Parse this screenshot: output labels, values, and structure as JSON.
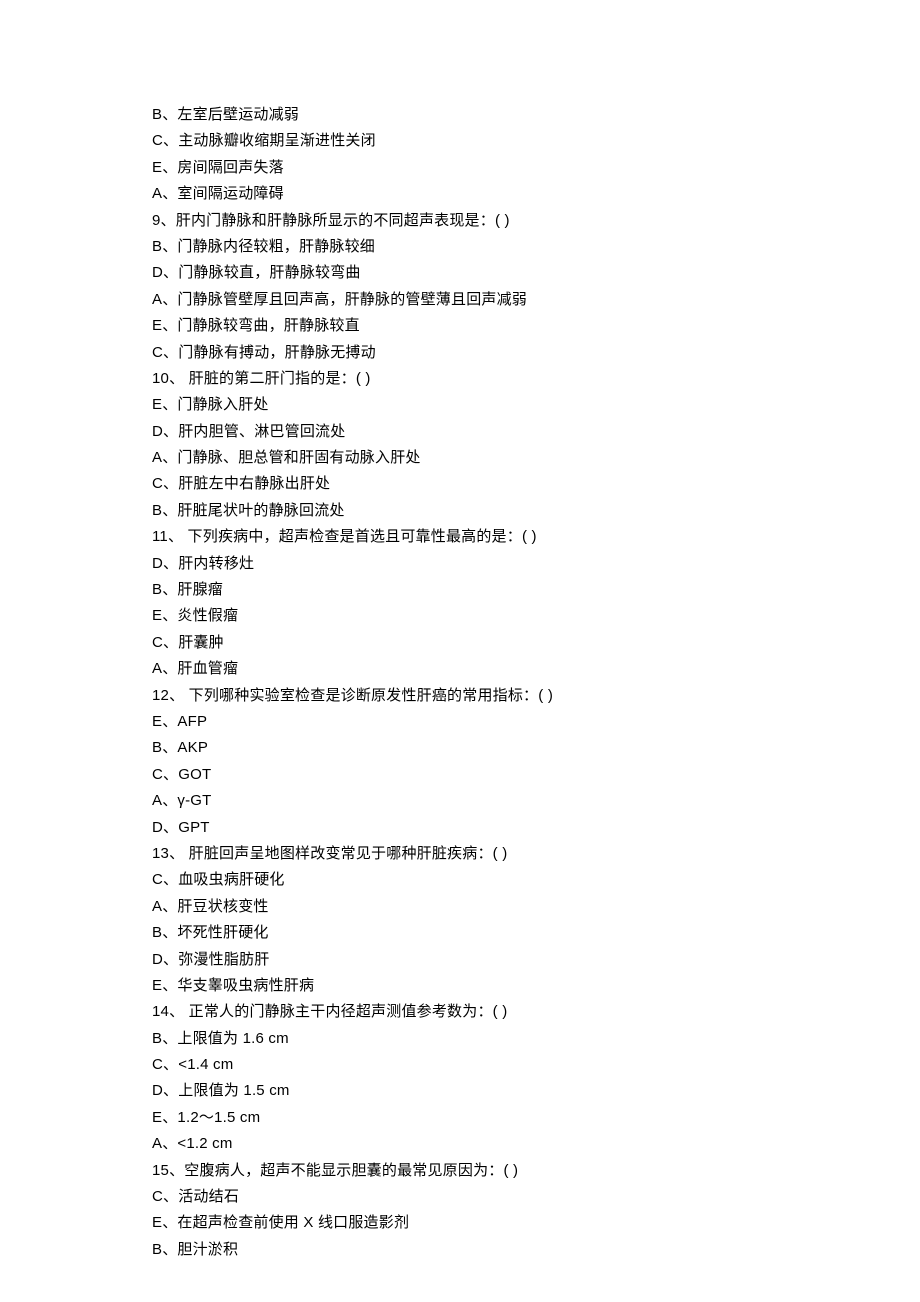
{
  "lines": [
    "B、左室后壁运动减弱",
    "C、主动脉瓣收缩期呈渐进性关闭",
    "E、房间隔回声失落",
    "A、室间隔运动障碍",
    "9、肝内门静脉和肝静脉所显示的不同超声表现是：(  )",
    "B、门静脉内径较粗，肝静脉较细",
    "D、门静脉较直，肝静脉较弯曲",
    "A、门静脉管壁厚且回声高，肝静脉的管壁薄且回声减弱",
    "E、门静脉较弯曲，肝静脉较直",
    "C、门静脉有搏动，肝静脉无搏动",
    "10、  肝脏的第二肝门指的是：(  )",
    "E、门静脉入肝处",
    "D、肝内胆管、淋巴管回流处",
    "A、门静脉、胆总管和肝固有动脉入肝处",
    "C、肝脏左中右静脉出肝处",
    "B、肝脏尾状叶的静脉回流处",
    "11、  下列疾病中，超声检查是首选且可靠性最高的是：(  )",
    "D、肝内转移灶",
    "B、肝腺瘤",
    "E、炎性假瘤",
    "C、肝囊肿",
    "A、肝血管瘤",
    "12、  下列哪种实验室检查是诊断原发性肝癌的常用指标：(  )",
    "E、AFP",
    "B、AKP",
    "C、GOT",
    "A、γ-GT",
    "D、GPT",
    "13、  肝脏回声呈地图样改变常见于哪种肝脏疾病：(  )",
    "C、血吸虫病肝硬化",
    "A、肝豆状核变性",
    "B、坏死性肝硬化",
    "D、弥漫性脂肪肝",
    "E、华支睾吸虫病性肝病",
    "14、  正常人的门静脉主干内径超声测值参考数为：(  )",
    "B、上限值为 1.6 cm",
    "C、<1.4 cm",
    "D、上限值为 1.5 cm",
    "E、1.2～1.5 cm",
    "A、<1.2 cm",
    "15、空腹病人，超声不能显示胆囊的最常见原因为：(  )",
    "C、活动结石",
    "E、在超声检查前使用 X 线口服造影剂",
    "B、胆汁淤积"
  ]
}
